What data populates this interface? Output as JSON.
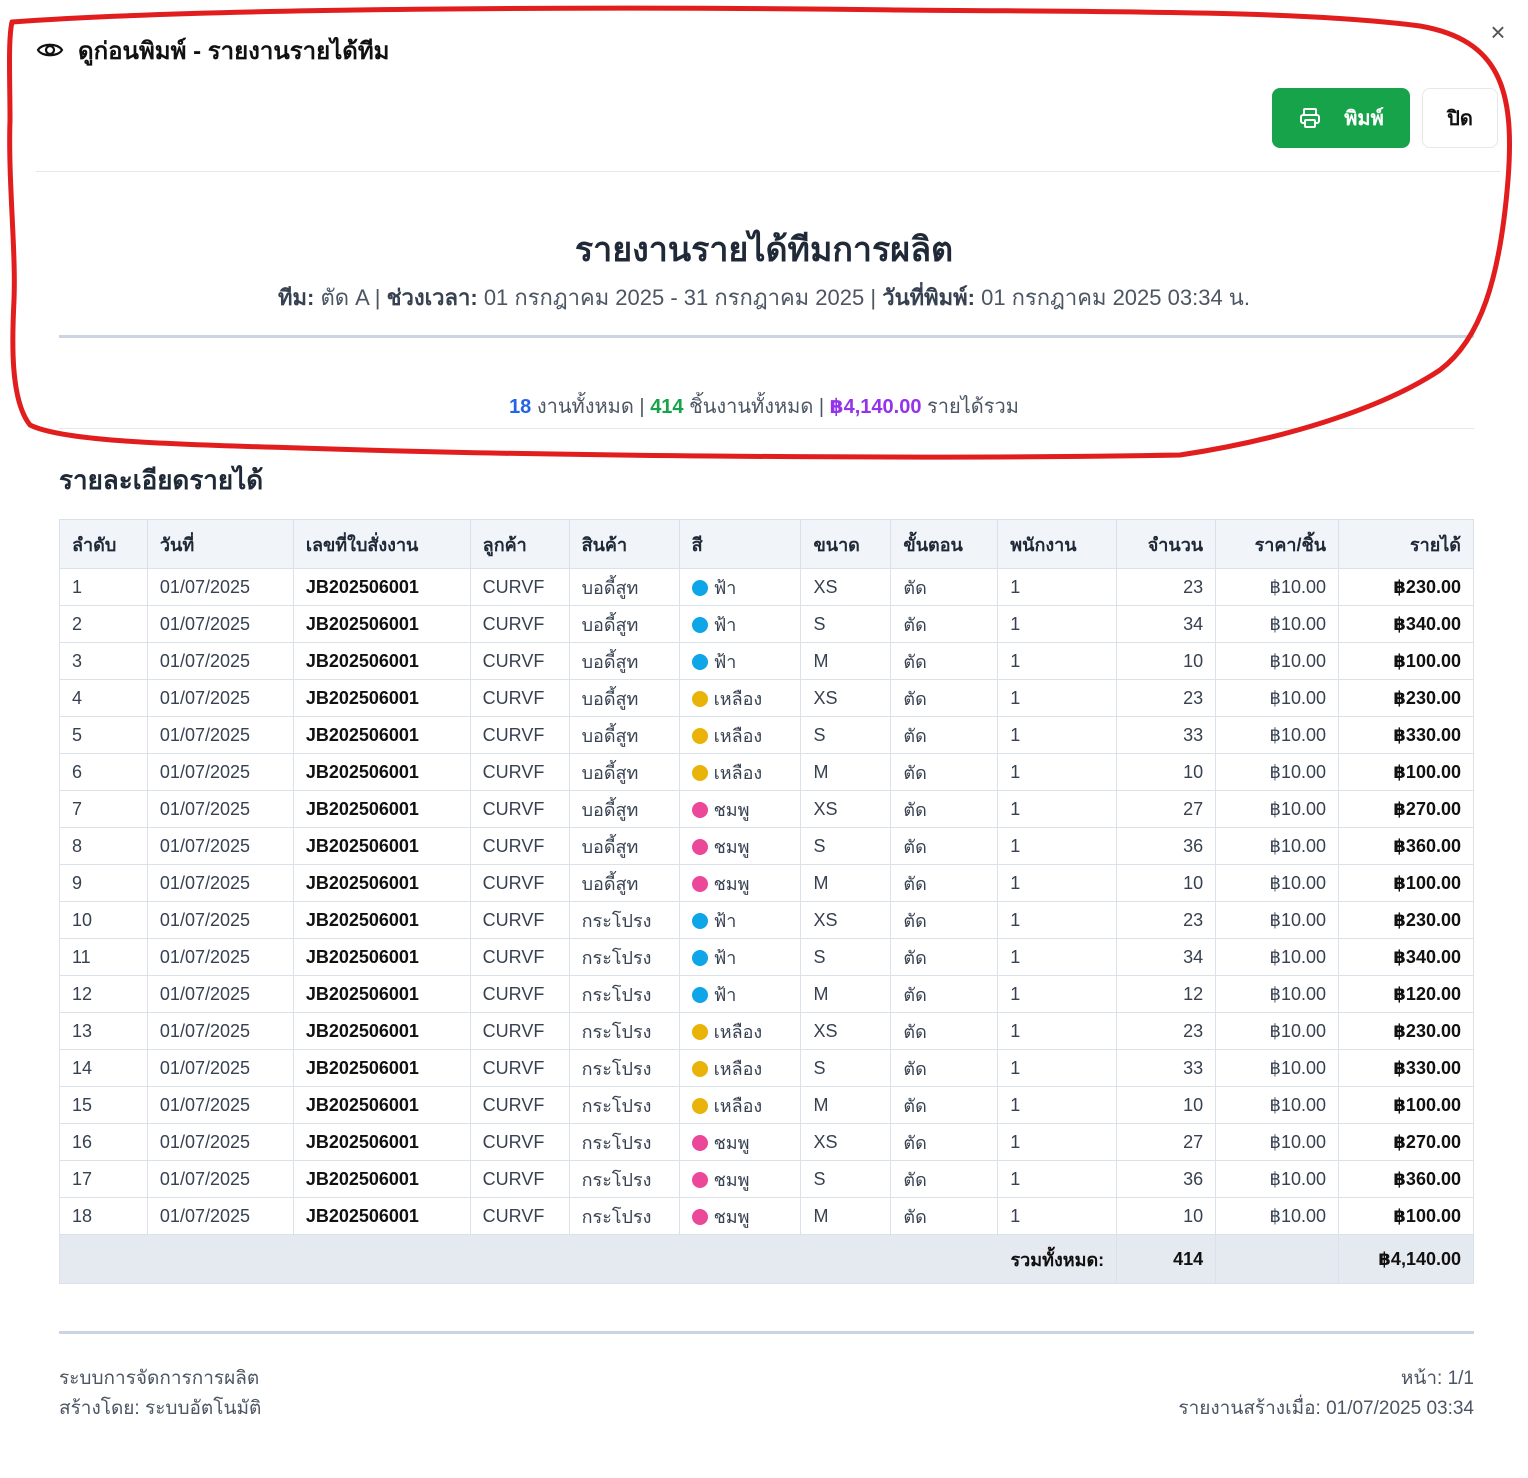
{
  "dialog": {
    "title": "ดูก่อนพิมพ์ - รายงานรายได้ทีม",
    "close_glyph": "×",
    "print_label": "พิมพ์",
    "close_label": "ปิด"
  },
  "report": {
    "title": "รายงานรายได้ทีมการผลิต",
    "team_label": "ทีม:",
    "team_value": "ตัด A",
    "period_label": "ช่วงเวลา:",
    "period_value": "01 กรกฎาคม 2025 - 31 กรกฎาคม 2025",
    "printed_label": "วันที่พิมพ์:",
    "printed_value": "01 กรกฎาคม 2025 03:34 น.",
    "sep": "|"
  },
  "summary": {
    "jobs_count": "18",
    "jobs_label": "งานทั้งหมด",
    "pieces_count": "414",
    "pieces_label": "ชิ้นงานทั้งหมด",
    "revenue_total": "฿4,140.00",
    "revenue_label": "รายได้รวม",
    "sep": "|"
  },
  "section_title": "รายละเอียดรายได้",
  "table": {
    "headers": [
      "ลำดับ",
      "วันที่",
      "เลขที่ใบสั่งงาน",
      "ลูกค้า",
      "สินค้า",
      "สี",
      "ขนาด",
      "ขั้นตอน",
      "พนักงาน",
      "จำนวน",
      "ราคา/ชิ้น",
      "รายได้"
    ],
    "rows": [
      [
        "1",
        "01/07/2025",
        "JB202506001",
        "CURVF",
        "บอดี้สูท",
        "ฟ้า",
        "XS",
        "ตัด",
        "1",
        "23",
        "฿10.00",
        "฿230.00"
      ],
      [
        "2",
        "01/07/2025",
        "JB202506001",
        "CURVF",
        "บอดี้สูท",
        "ฟ้า",
        "S",
        "ตัด",
        "1",
        "34",
        "฿10.00",
        "฿340.00"
      ],
      [
        "3",
        "01/07/2025",
        "JB202506001",
        "CURVF",
        "บอดี้สูท",
        "ฟ้า",
        "M",
        "ตัด",
        "1",
        "10",
        "฿10.00",
        "฿100.00"
      ],
      [
        "4",
        "01/07/2025",
        "JB202506001",
        "CURVF",
        "บอดี้สูท",
        "เหลือง",
        "XS",
        "ตัด",
        "1",
        "23",
        "฿10.00",
        "฿230.00"
      ],
      [
        "5",
        "01/07/2025",
        "JB202506001",
        "CURVF",
        "บอดี้สูท",
        "เหลือง",
        "S",
        "ตัด",
        "1",
        "33",
        "฿10.00",
        "฿330.00"
      ],
      [
        "6",
        "01/07/2025",
        "JB202506001",
        "CURVF",
        "บอดี้สูท",
        "เหลือง",
        "M",
        "ตัด",
        "1",
        "10",
        "฿10.00",
        "฿100.00"
      ],
      [
        "7",
        "01/07/2025",
        "JB202506001",
        "CURVF",
        "บอดี้สูท",
        "ชมพู",
        "XS",
        "ตัด",
        "1",
        "27",
        "฿10.00",
        "฿270.00"
      ],
      [
        "8",
        "01/07/2025",
        "JB202506001",
        "CURVF",
        "บอดี้สูท",
        "ชมพู",
        "S",
        "ตัด",
        "1",
        "36",
        "฿10.00",
        "฿360.00"
      ],
      [
        "9",
        "01/07/2025",
        "JB202506001",
        "CURVF",
        "บอดี้สูท",
        "ชมพู",
        "M",
        "ตัด",
        "1",
        "10",
        "฿10.00",
        "฿100.00"
      ],
      [
        "10",
        "01/07/2025",
        "JB202506001",
        "CURVF",
        "กระโปรง",
        "ฟ้า",
        "XS",
        "ตัด",
        "1",
        "23",
        "฿10.00",
        "฿230.00"
      ],
      [
        "11",
        "01/07/2025",
        "JB202506001",
        "CURVF",
        "กระโปรง",
        "ฟ้า",
        "S",
        "ตัด",
        "1",
        "34",
        "฿10.00",
        "฿340.00"
      ],
      [
        "12",
        "01/07/2025",
        "JB202506001",
        "CURVF",
        "กระโปรง",
        "ฟ้า",
        "M",
        "ตัด",
        "1",
        "12",
        "฿10.00",
        "฿120.00"
      ],
      [
        "13",
        "01/07/2025",
        "JB202506001",
        "CURVF",
        "กระโปรง",
        "เหลือง",
        "XS",
        "ตัด",
        "1",
        "23",
        "฿10.00",
        "฿230.00"
      ],
      [
        "14",
        "01/07/2025",
        "JB202506001",
        "CURVF",
        "กระโปรง",
        "เหลือง",
        "S",
        "ตัด",
        "1",
        "33",
        "฿10.00",
        "฿330.00"
      ],
      [
        "15",
        "01/07/2025",
        "JB202506001",
        "CURVF",
        "กระโปรง",
        "เหลือง",
        "M",
        "ตัด",
        "1",
        "10",
        "฿10.00",
        "฿100.00"
      ],
      [
        "16",
        "01/07/2025",
        "JB202506001",
        "CURVF",
        "กระโปรง",
        "ชมพู",
        "XS",
        "ตัด",
        "1",
        "27",
        "฿10.00",
        "฿270.00"
      ],
      [
        "17",
        "01/07/2025",
        "JB202506001",
        "CURVF",
        "กระโปรง",
        "ชมพู",
        "S",
        "ตัด",
        "1",
        "36",
        "฿10.00",
        "฿360.00"
      ],
      [
        "18",
        "01/07/2025",
        "JB202506001",
        "CURVF",
        "กระโปรง",
        "ชมพู",
        "M",
        "ตัด",
        "1",
        "10",
        "฿10.00",
        "฿100.00"
      ]
    ],
    "color_dots": {
      "ฟ้า": "#0ea5e9",
      "เหลือง": "#eab308",
      "ชมพู": "#ec4899"
    },
    "total_label": "รวมทั้งหมด:",
    "total_qty": "414",
    "total_revenue": "฿4,140.00"
  },
  "footer": {
    "system_name": "ระบบการจัดการการผลิต",
    "created_by": "สร้างโดย: ระบบอัตโนมัติ",
    "page": "หน้า: 1/1",
    "generated_at": "รายงานสร้างเมื่อ: 01/07/2025 03:34"
  },
  "colors": {
    "print_button": "#16a34a",
    "annotation": "#e11d1d",
    "jobs_count": "#2563eb",
    "pieces_count": "#16a34a",
    "revenue_total": "#9333ea"
  }
}
